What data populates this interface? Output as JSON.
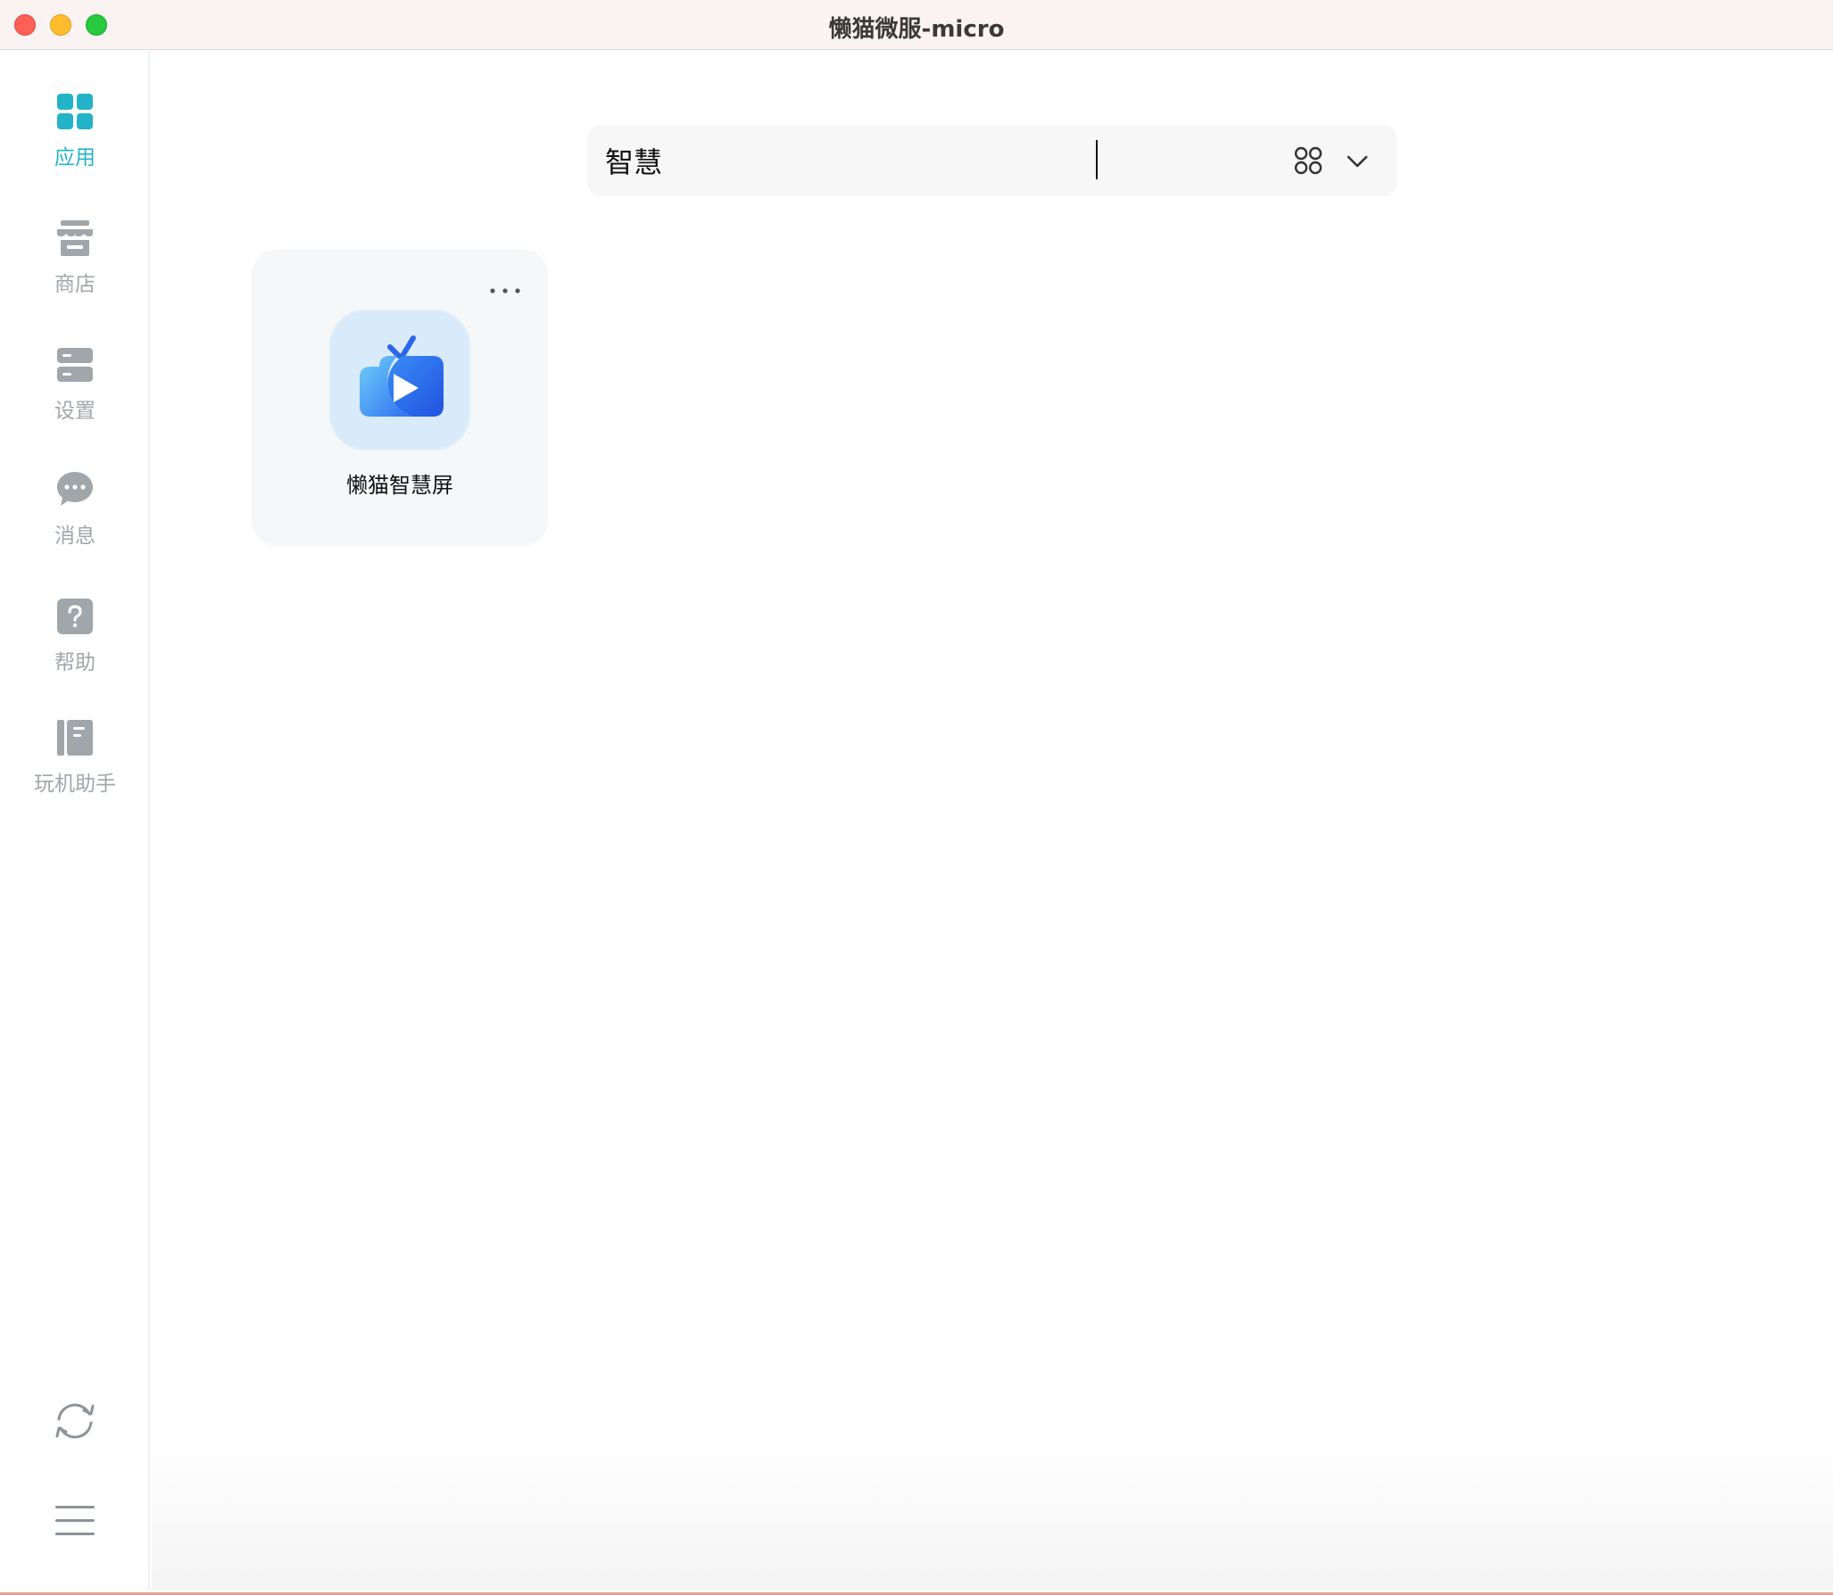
{
  "window": {
    "title": "懒猫微服-micro"
  },
  "sidebar": {
    "items": [
      {
        "label": "应用",
        "icon": "apps-grid-icon",
        "active": true
      },
      {
        "label": "商店",
        "icon": "store-icon",
        "active": false
      },
      {
        "label": "设置",
        "icon": "settings-icon",
        "active": false
      },
      {
        "label": "消息",
        "icon": "message-icon",
        "active": false
      },
      {
        "label": "帮助",
        "icon": "help-icon",
        "active": false
      },
      {
        "label": "玩机助手",
        "icon": "guide-book-icon",
        "active": false
      }
    ],
    "bottom": {
      "sync_icon": "sync-icon",
      "menu_icon": "hamburger-menu-icon"
    }
  },
  "search": {
    "value": "智慧",
    "view_toggle_icon": "grid-view-icon",
    "dropdown_icon": "chevron-down-icon"
  },
  "apps": [
    {
      "name": "懒猫智慧屏",
      "icon": "smart-screen-tv-icon"
    }
  ],
  "colors": {
    "accent": "#22b3c8",
    "inactive": "#a1a6ab"
  }
}
